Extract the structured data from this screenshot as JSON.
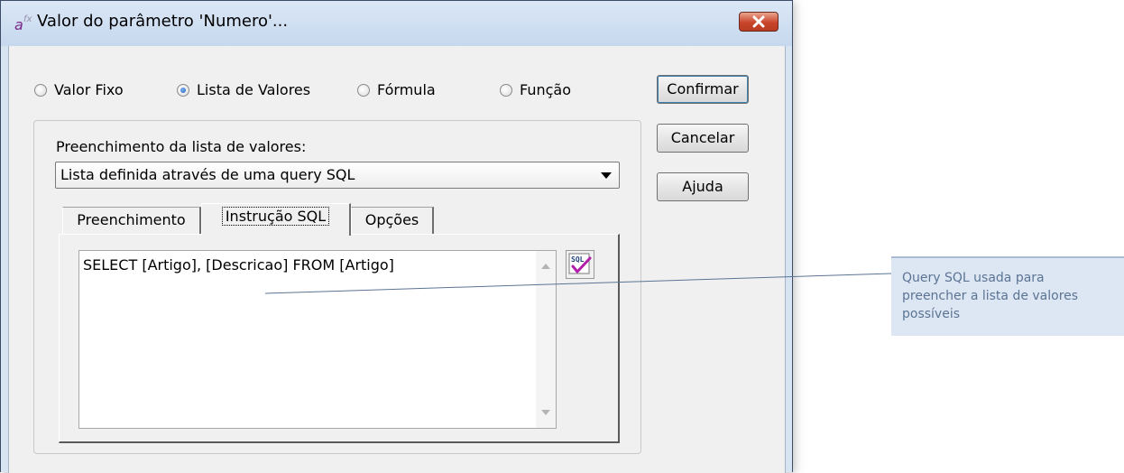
{
  "window": {
    "title": "Valor do parâmetro 'Numero'...",
    "close_label": "✕"
  },
  "radio_options": [
    {
      "label": "Valor Fixo",
      "selected": false
    },
    {
      "label": "Lista de Valores",
      "selected": true
    },
    {
      "label": "Fórmula",
      "selected": false
    },
    {
      "label": "Função",
      "selected": false
    }
  ],
  "buttons": {
    "confirm": "Confirmar",
    "cancel": "Cancelar",
    "help": "Ajuda"
  },
  "fill_list": {
    "label": "Preenchimento da lista de valores:",
    "selected_value": "Lista definida através de uma query SQL"
  },
  "tabs": [
    {
      "label": "Preenchimento",
      "active": false
    },
    {
      "label": "Instrução SQL",
      "active": true
    },
    {
      "label": "Opções",
      "active": false
    }
  ],
  "sql_editor": {
    "value": "SELECT [Artigo], [Descricao] FROM [Artigo]"
  },
  "sql_icon_label": "SQL",
  "callout": {
    "text": "Query SQL usada para preencher a lista de valores possíveis"
  },
  "colors": {
    "title_bar": "#c6d8ee",
    "close_button": "#c9452b",
    "callout_bg": "#dde7f3",
    "callout_text": "#5b7494",
    "radio_selected": "#1f5fb8"
  }
}
